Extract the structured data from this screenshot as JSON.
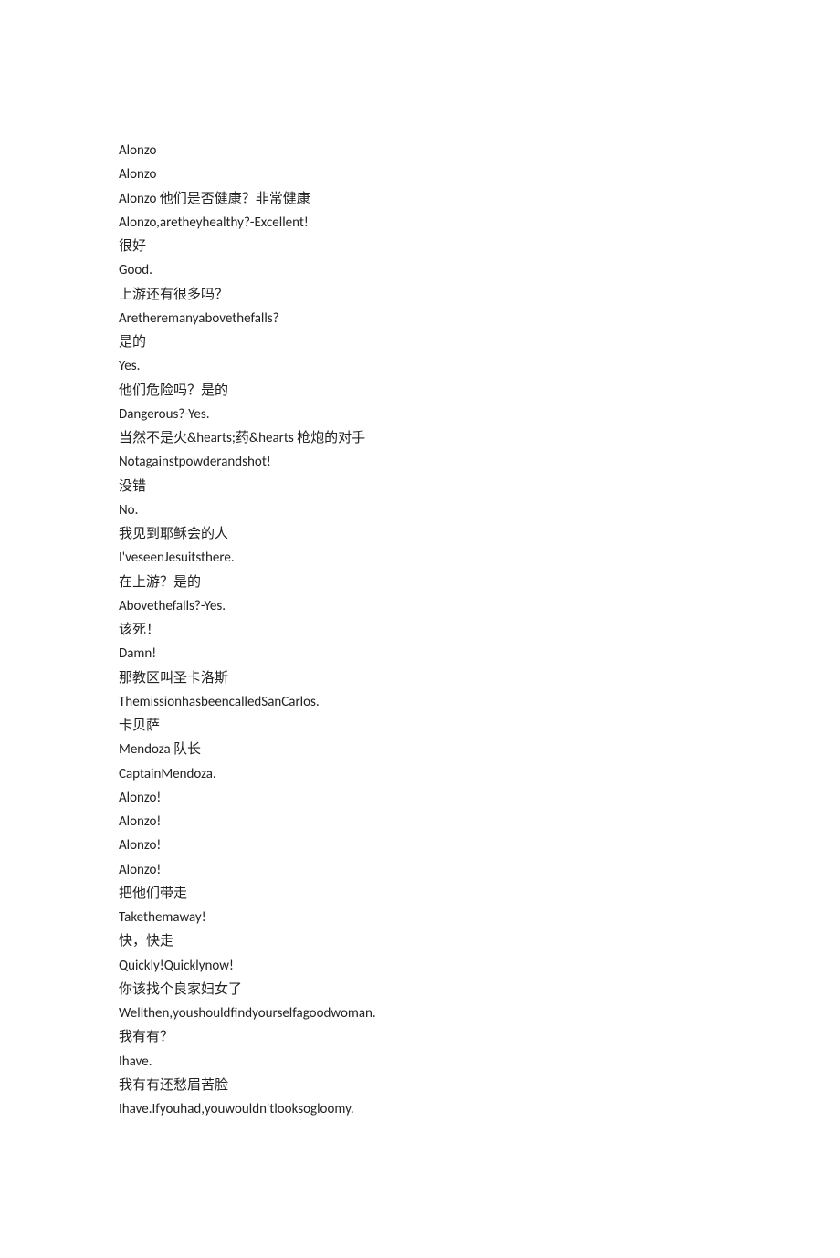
{
  "lines": [
    "Alonzo",
    "Alonzo",
    "Alonzo 他们是否健康？非常健康",
    "Alonzo,aretheyhealthy?-Excellent!",
    "很好",
    "Good.",
    "上游还有很多吗？",
    "Aretheremanyabovethefalls?",
    "是的",
    "Yes.",
    "他们危险吗？是的",
    "Dangerous?-Yes.",
    "当然不是火&hearts;药&hearts 枪炮的对手",
    "Notagainstpowderandshot!",
    "没错",
    "No.",
    "我见到耶稣会的人",
    "I'veseenJesuitsthere.",
    "在上游？是的",
    "Abovethefalls?-Yes.",
    "该死！",
    "Damn!",
    "那教区叫圣卡洛斯",
    "ThemissionhasbeencalledSanCarlos.",
    "卡贝萨",
    "Mendoza 队长",
    "CaptainMendoza.",
    "Alonzo!",
    "Alonzo!",
    "Alonzo!",
    "Alonzo!",
    "把他们带走",
    "Takethemaway!",
    "快，快走",
    "Quickly!Quicklynow!",
    "你该找个良家妇女了",
    "Wellthen,youshouldfindyourselfagoodwoman.",
    "我有有？",
    "Ihave.",
    "我有有还愁眉苦脸",
    "Ihave.Ifyouhad,youwouldn'tlooksogloomy."
  ]
}
